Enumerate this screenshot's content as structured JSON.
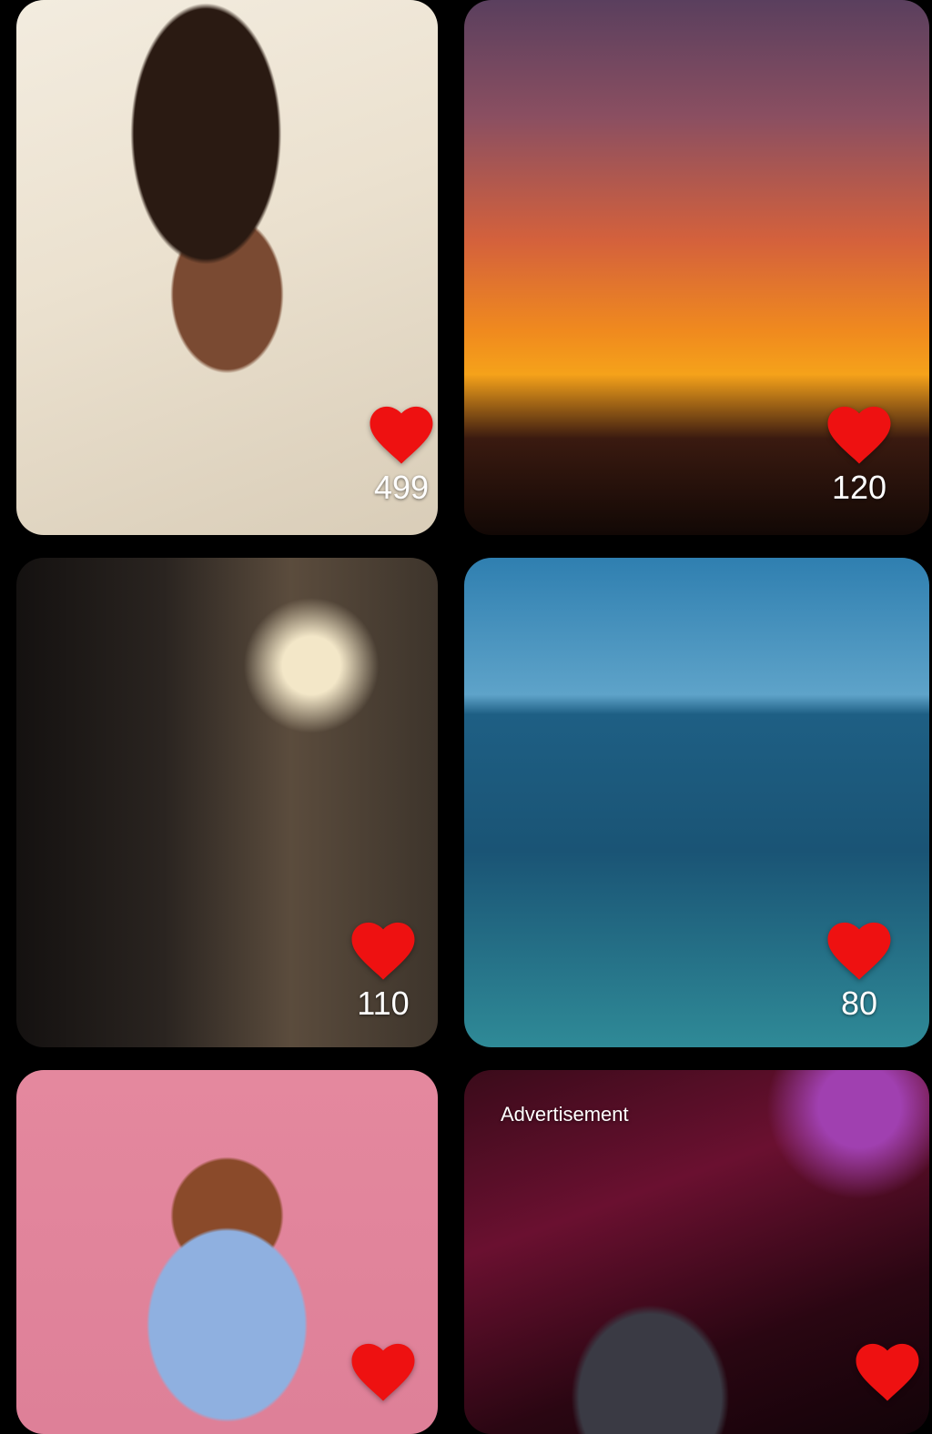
{
  "feed": {
    "cards": [
      {
        "likes": "499"
      },
      {
        "likes": "120"
      },
      {
        "likes": "110"
      },
      {
        "likes": "80"
      },
      {
        "likes": ""
      },
      {
        "likes": "",
        "ad_label": "Advertisement"
      }
    ]
  },
  "icons": {
    "like": "heart-icon"
  },
  "colors": {
    "background": "#000000",
    "heart": "#ee1111",
    "count_text": "#ffffff"
  }
}
